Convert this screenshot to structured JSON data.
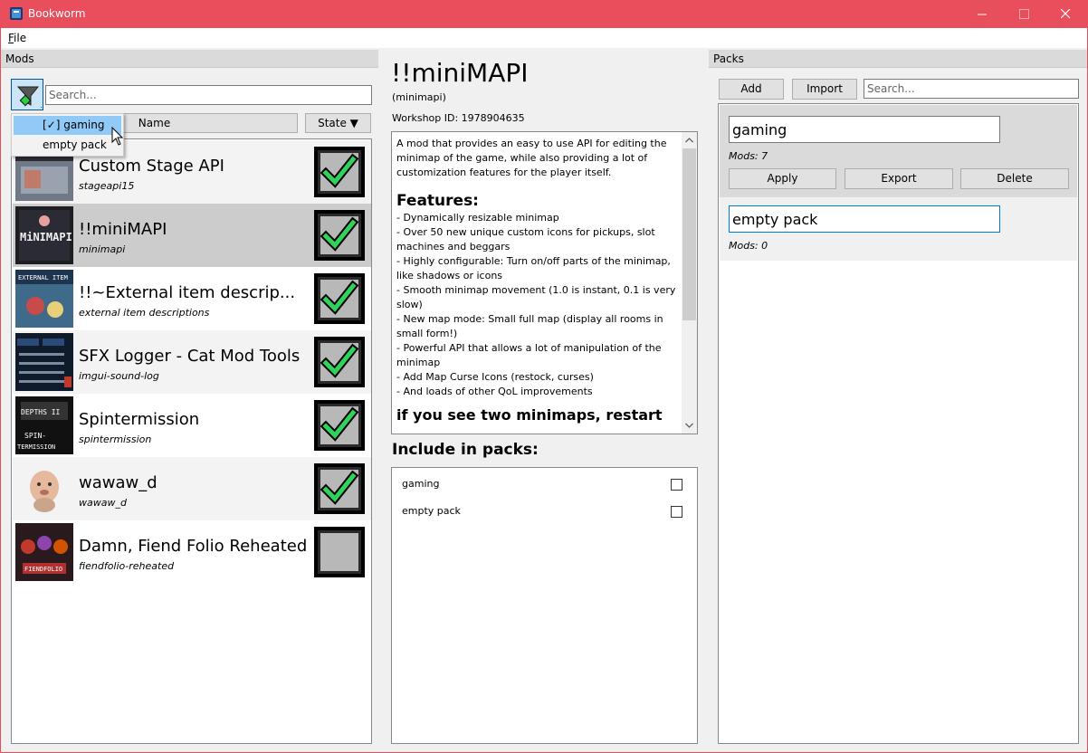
{
  "window": {
    "title": "Bookworm",
    "accent_color": "#e84e5c"
  },
  "menu": {
    "file_label": "File"
  },
  "mods_panel": {
    "header": "Mods",
    "search_placeholder": "Search...",
    "columns": {
      "name": "Name",
      "state": "State ▼"
    },
    "filter_popup": {
      "items": [
        {
          "label": "[✓] gaming",
          "highlighted": true
        },
        {
          "label": "empty pack",
          "highlighted": false
        }
      ]
    },
    "mods": [
      {
        "name": "Custom Stage API",
        "id": "stageapi15",
        "enabled": true,
        "selected": false,
        "thumb": "custom-stage-api-thumbnail"
      },
      {
        "name": "!!miniMAPI",
        "id": "minimapi",
        "enabled": true,
        "selected": true,
        "thumb": "minimapi-thumbnail"
      },
      {
        "name": "!!~External item descrip...",
        "id": "external item descriptions",
        "enabled": true,
        "selected": false,
        "thumb": "external-item-descriptions-thumbnail"
      },
      {
        "name": "SFX Logger - Cat Mod Tools",
        "id": "imgui-sound-log",
        "enabled": true,
        "selected": false,
        "thumb": "sfx-logger-thumbnail"
      },
      {
        "name": "Spintermission",
        "id": "spintermission",
        "enabled": true,
        "selected": false,
        "thumb": "spintermission-thumbnail"
      },
      {
        "name": "wawaw_d",
        "id": "wawaw_d",
        "enabled": true,
        "selected": false,
        "thumb": "wawaw-d-thumbnail"
      },
      {
        "name": "Damn, Fiend Folio Reheated",
        "id": "fiendfolio-reheated",
        "enabled": false,
        "selected": false,
        "thumb": "fiend-folio-thumbnail"
      }
    ]
  },
  "detail": {
    "title": "!!miniMAPI",
    "id_label": "(minimapi)",
    "workshop_label": "Workshop ID: 1978904635",
    "description_intro": "A mod that provides an easy to use API for editing the minimap of the game, while also providing a lot of customization features for the player itself.",
    "features_heading": "Features:",
    "features": [
      "- Dynamically resizable minimap",
      "- Over 50 new unique custom icons for pickups, slot machines and beggars",
      "- Highly configurable: Turn on/off parts of the minimap, like shadows or icons",
      "- Smooth minimap movement (1.0 is instant, 0.1 is very slow)",
      "- New map mode: Small full map (display all rooms in small form!)",
      "- Powerful API that allows a lot of manipulation of the minimap",
      "- Add Map Curse Icons (restock, curses)",
      "- And loads of other QoL improvements"
    ],
    "tail_heading": "if you see two minimaps, restart",
    "include_label": "Include in packs:",
    "include_packs": [
      {
        "name": "gaming",
        "checked": false
      },
      {
        "name": "empty pack",
        "checked": false
      }
    ]
  },
  "packs_panel": {
    "header": "Packs",
    "add_label": "Add",
    "import_label": "Import",
    "search_placeholder": "Search...",
    "packs": [
      {
        "name": "gaming",
        "count": "Mods: 7",
        "selected": true,
        "actions": {
          "apply": "Apply",
          "export": "Export",
          "delete": "Delete"
        }
      },
      {
        "name": "empty pack",
        "count": "Mods: 0",
        "selected": false
      }
    ]
  }
}
